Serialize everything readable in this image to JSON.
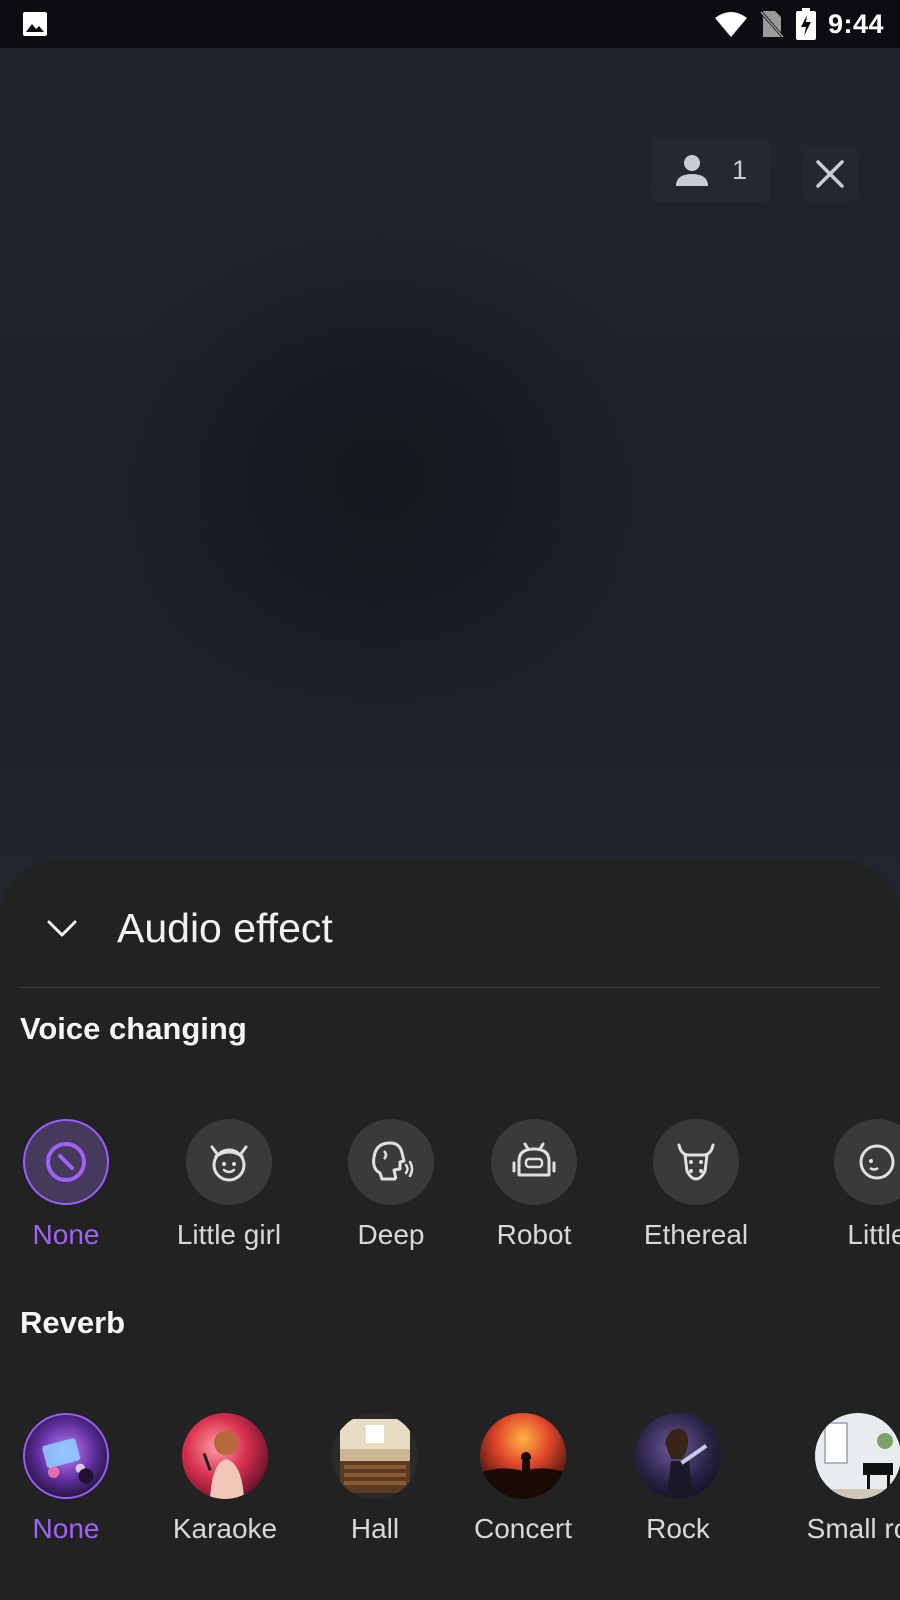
{
  "status_bar": {
    "time": "9:44",
    "icons": [
      "gallery-icon",
      "wifi-icon",
      "no-sim-icon",
      "battery-charging-icon"
    ]
  },
  "room": {
    "participant_count": "1",
    "icons": [
      "person-icon",
      "close-icon"
    ]
  },
  "sheet": {
    "title": "Audio effect",
    "voice_changing": {
      "title": "Voice changing",
      "items": [
        {
          "label": "None",
          "icon": "none-icon",
          "selected": true
        },
        {
          "label": "Little girl",
          "icon": "little-girl-icon",
          "selected": false
        },
        {
          "label": "Deep",
          "icon": "deep-voice-icon",
          "selected": false
        },
        {
          "label": "Robot",
          "icon": "robot-icon",
          "selected": false
        },
        {
          "label": "Ethereal",
          "icon": "ethereal-icon",
          "selected": false
        },
        {
          "label": "Little",
          "icon": "little-boy-icon",
          "selected": false
        }
      ]
    },
    "reverb": {
      "title": "Reverb",
      "items": [
        {
          "label": "None",
          "selected": true
        },
        {
          "label": "Karaoke",
          "selected": false
        },
        {
          "label": "Hall",
          "selected": false
        },
        {
          "label": "Concert",
          "selected": false
        },
        {
          "label": "Rock",
          "selected": false
        },
        {
          "label": "Small ro",
          "selected": false
        }
      ]
    }
  },
  "colors": {
    "accent": "#a162f7",
    "sheet_bg": "#222222",
    "icon_bg": "#3a3a3a"
  }
}
